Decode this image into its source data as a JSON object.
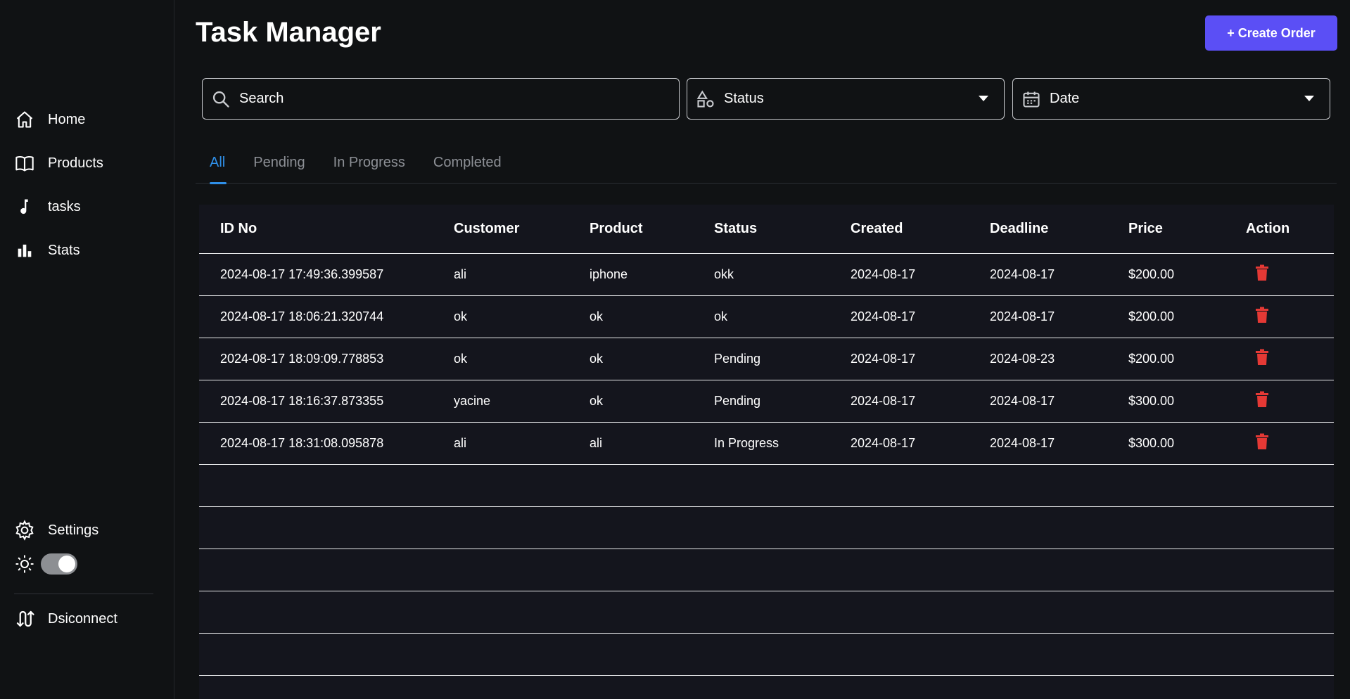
{
  "app": {
    "title": "Task Manager"
  },
  "colors": {
    "accent": "#5b4ff5",
    "tab_active": "#2f8fe8",
    "danger": "#e53935",
    "background": "#101214",
    "table_bg": "#14151d"
  },
  "sidebar": {
    "items": [
      {
        "label": "Home",
        "icon": "home-icon"
      },
      {
        "label": "Products",
        "icon": "book-icon"
      },
      {
        "label": "tasks",
        "icon": "music-note-icon"
      },
      {
        "label": "Stats",
        "icon": "bar-chart-icon"
      }
    ],
    "settings_label": "Settings",
    "theme_toggle": {
      "icon": "sun-icon",
      "state": "on"
    },
    "disconnect_label": "Dsiconnect"
  },
  "header": {
    "create_label": "+ Create Order"
  },
  "filters": {
    "search_placeholder": "Search",
    "status_label": "Status",
    "date_label": "Date"
  },
  "tabs": [
    "All",
    "Pending",
    "In Progress",
    "Completed"
  ],
  "active_tab": "All",
  "table": {
    "columns": [
      "ID No",
      "Customer",
      "Product",
      "Status",
      "Created",
      "Deadline",
      "Price",
      "Action"
    ],
    "rows": [
      {
        "id": "2024-08-17 17:49:36.399587",
        "customer": "ali",
        "product": "iphone",
        "status": "okk",
        "created": "2024-08-17",
        "deadline": "2024-08-17",
        "price": "$200.00"
      },
      {
        "id": "2024-08-17 18:06:21.320744",
        "customer": "ok",
        "product": "ok",
        "status": "ok",
        "created": "2024-08-17",
        "deadline": "2024-08-17",
        "price": "$200.00"
      },
      {
        "id": "2024-08-17 18:09:09.778853",
        "customer": "ok",
        "product": "ok",
        "status": "Pending",
        "created": "2024-08-17",
        "deadline": "2024-08-23",
        "price": "$200.00"
      },
      {
        "id": "2024-08-17 18:16:37.873355",
        "customer": "yacine",
        "product": "ok",
        "status": "Pending",
        "created": "2024-08-17",
        "deadline": "2024-08-17",
        "price": "$300.00"
      },
      {
        "id": "2024-08-17 18:31:08.095878",
        "customer": "ali",
        "product": "ali",
        "status": "In Progress",
        "created": "2024-08-17",
        "deadline": "2024-08-17",
        "price": "$300.00"
      }
    ]
  }
}
